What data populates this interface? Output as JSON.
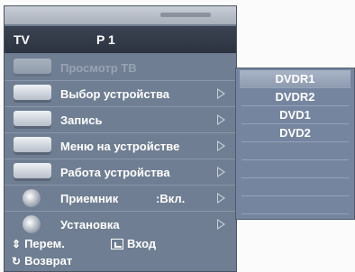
{
  "header": {
    "source": "TV",
    "program": "P 1"
  },
  "menu": {
    "items": [
      {
        "label": "Просмотр ТВ",
        "icon": "tv-view-icon",
        "disabled": true
      },
      {
        "label": "Выбор устройства",
        "icon": "device-select-icon"
      },
      {
        "label": "Запись",
        "icon": "record-icon"
      },
      {
        "label": "Меню на устройстве",
        "icon": "device-menu-icon"
      },
      {
        "label": "Работа устройства",
        "icon": "device-operation-icon"
      },
      {
        "label": "Приемник",
        "value": ":Вкл.",
        "icon": "receiver-icon"
      },
      {
        "label": "Установка",
        "icon": "settings-gear-icon"
      }
    ]
  },
  "footer": {
    "move": "Перем.",
    "enter": "Вход",
    "back": "Возврат"
  },
  "submenu": {
    "items": [
      "DVDR1",
      "DVDR2",
      "DVD1",
      "DVD2"
    ],
    "selected": "DVDR1"
  },
  "colors": {
    "panel": "#6f7e92",
    "header": "#2c3340",
    "submenu": "#7585a0",
    "highlight": "#a9b5c7"
  }
}
